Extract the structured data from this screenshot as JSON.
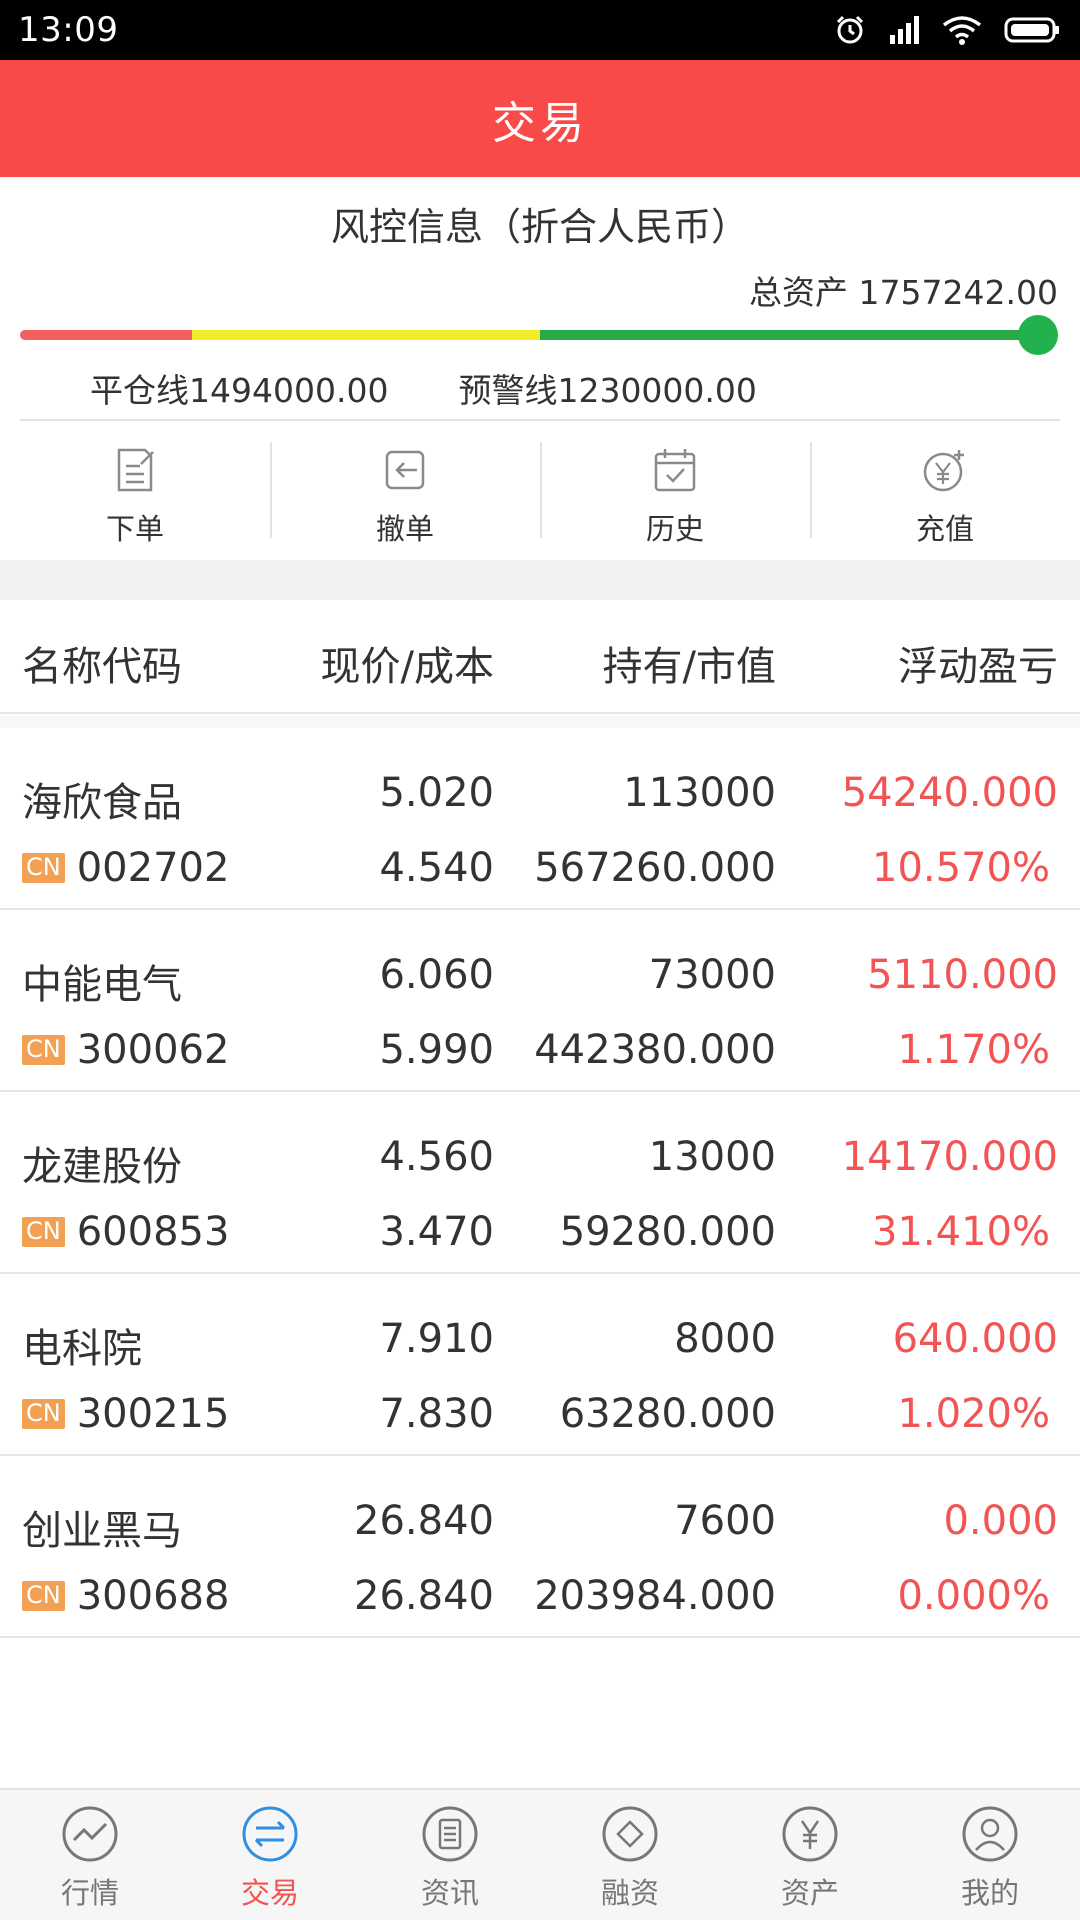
{
  "status_bar": {
    "time": "13:09"
  },
  "header": {
    "title": "交易"
  },
  "risk": {
    "title": "风控信息（折合人民币）",
    "total_assets_label": "总资产",
    "total_assets_value": "1757242.00",
    "liquidation_line": "平仓线1494000.00",
    "warning_line": "预警线1230000.00",
    "colors": {
      "red": "#f25f5f",
      "yellow": "#f0ec2a",
      "green": "#27a944"
    }
  },
  "actions": [
    {
      "label": "下单",
      "icon": "order-icon"
    },
    {
      "label": "撤单",
      "icon": "cancel-order-icon"
    },
    {
      "label": "历史",
      "icon": "history-calendar-icon"
    },
    {
      "label": "充值",
      "icon": "recharge-yen-icon"
    }
  ],
  "table": {
    "headers": [
      "名称代码",
      "现价/成本",
      "持有/市值",
      "浮动盈亏"
    ],
    "rows": [
      {
        "name": "海欣食品",
        "market": "CN",
        "code": "002702",
        "price": "5.020",
        "cost": "4.540",
        "hold": "113000",
        "market_value": "567260.000",
        "pl": "54240.000",
        "pl_pct": "10.570%"
      },
      {
        "name": "中能电气",
        "market": "CN",
        "code": "300062",
        "price": "6.060",
        "cost": "5.990",
        "hold": "73000",
        "market_value": "442380.000",
        "pl": "5110.000",
        "pl_pct": "1.170%"
      },
      {
        "name": "龙建股份",
        "market": "CN",
        "code": "600853",
        "price": "4.560",
        "cost": "3.470",
        "hold": "13000",
        "market_value": "59280.000",
        "pl": "14170.000",
        "pl_pct": "31.410%"
      },
      {
        "name": "电科院",
        "market": "CN",
        "code": "300215",
        "price": "7.910",
        "cost": "7.830",
        "hold": "8000",
        "market_value": "63280.000",
        "pl": "640.000",
        "pl_pct": "1.020%"
      },
      {
        "name": "创业黑马",
        "market": "CN",
        "code": "300688",
        "price": "26.840",
        "cost": "26.840",
        "hold": "7600",
        "market_value": "203984.000",
        "pl": "0.000",
        "pl_pct": "0.000%"
      }
    ]
  },
  "bottom_nav": [
    {
      "label": "行情",
      "icon": "market-chart-icon",
      "active": false
    },
    {
      "label": "交易",
      "icon": "trade-arrows-icon",
      "active": true
    },
    {
      "label": "资讯",
      "icon": "news-icon",
      "active": false
    },
    {
      "label": "融资",
      "icon": "financing-icon",
      "active": false
    },
    {
      "label": "资产",
      "icon": "assets-yen-icon",
      "active": false
    },
    {
      "label": "我的",
      "icon": "profile-icon",
      "active": false
    }
  ],
  "theme": {
    "primary": "#f94a4a",
    "profit": "#f25353",
    "badge": "#f2a154",
    "active_nav": "#2f8fe0"
  }
}
